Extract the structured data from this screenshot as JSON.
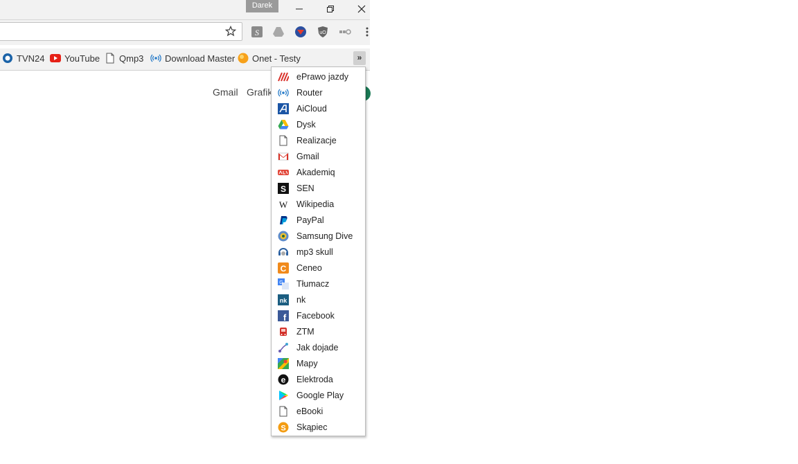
{
  "window": {
    "profile_name": "Darek"
  },
  "bookmarks_bar": {
    "items": [
      {
        "label": "TVN24",
        "icon": "tvn24-icon"
      },
      {
        "label": "YouTube",
        "icon": "youtube-icon"
      },
      {
        "label": "Qmp3",
        "icon": "page-icon"
      },
      {
        "label": "Download Master",
        "icon": "broadcast-icon"
      },
      {
        "label": "Onet - Testy",
        "icon": "onet-icon"
      }
    ],
    "overflow_symbol": "»"
  },
  "page": {
    "links": [
      "Gmail",
      "Grafik"
    ]
  },
  "overflow_menu": {
    "items": [
      {
        "label": "ePrawo jazdy",
        "icon": "eprawo-icon"
      },
      {
        "label": "Router",
        "icon": "broadcast-icon"
      },
      {
        "label": "AiCloud",
        "icon": "aicloud-icon"
      },
      {
        "label": "Dysk",
        "icon": "drive-icon"
      },
      {
        "label": "Realizacje",
        "icon": "page-icon"
      },
      {
        "label": "Gmail",
        "icon": "gmail-icon"
      },
      {
        "label": "Akademiq",
        "icon": "akademiq-icon"
      },
      {
        "label": "SEN",
        "icon": "sen-icon"
      },
      {
        "label": "Wikipedia",
        "icon": "wikipedia-icon"
      },
      {
        "label": "PayPal",
        "icon": "paypal-icon"
      },
      {
        "label": "Samsung Dive",
        "icon": "samsung-icon"
      },
      {
        "label": "mp3 skull",
        "icon": "mp3skull-icon"
      },
      {
        "label": "Ceneo",
        "icon": "ceneo-icon"
      },
      {
        "label": "Tłumacz",
        "icon": "translate-icon"
      },
      {
        "label": "nk",
        "icon": "nk-icon"
      },
      {
        "label": "Facebook",
        "icon": "facebook-icon"
      },
      {
        "label": "ZTM",
        "icon": "ztm-icon"
      },
      {
        "label": "Jak dojade",
        "icon": "route-icon"
      },
      {
        "label": "Mapy",
        "icon": "maps-icon"
      },
      {
        "label": "Elektroda",
        "icon": "elektroda-icon"
      },
      {
        "label": "Google Play",
        "icon": "play-icon"
      },
      {
        "label": "eBooki",
        "icon": "page-icon"
      },
      {
        "label": "Skąpiec",
        "icon": "skapiec-icon"
      }
    ]
  }
}
